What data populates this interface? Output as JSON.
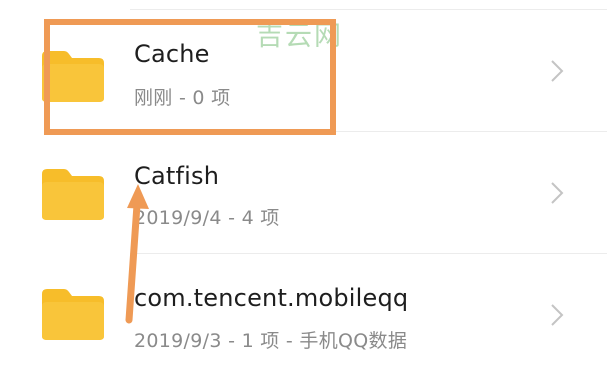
{
  "watermark": "吉云网",
  "files": [
    {
      "name": "Cache",
      "meta": "刚刚 - 0 项",
      "icon": "folder-icon"
    },
    {
      "name": "Catfish",
      "meta": "2019/9/4 - 4 项",
      "icon": "folder-icon"
    },
    {
      "name": "com.tencent.mobileqq",
      "meta": "2019/9/3 - 1 项 - 手机QQ数据",
      "icon": "folder-icon"
    }
  ],
  "colors": {
    "folder": "#f7bd2a",
    "folder_tab": "#f9cf55",
    "annotation": "#ef9a55",
    "watermark": "#78be78"
  }
}
